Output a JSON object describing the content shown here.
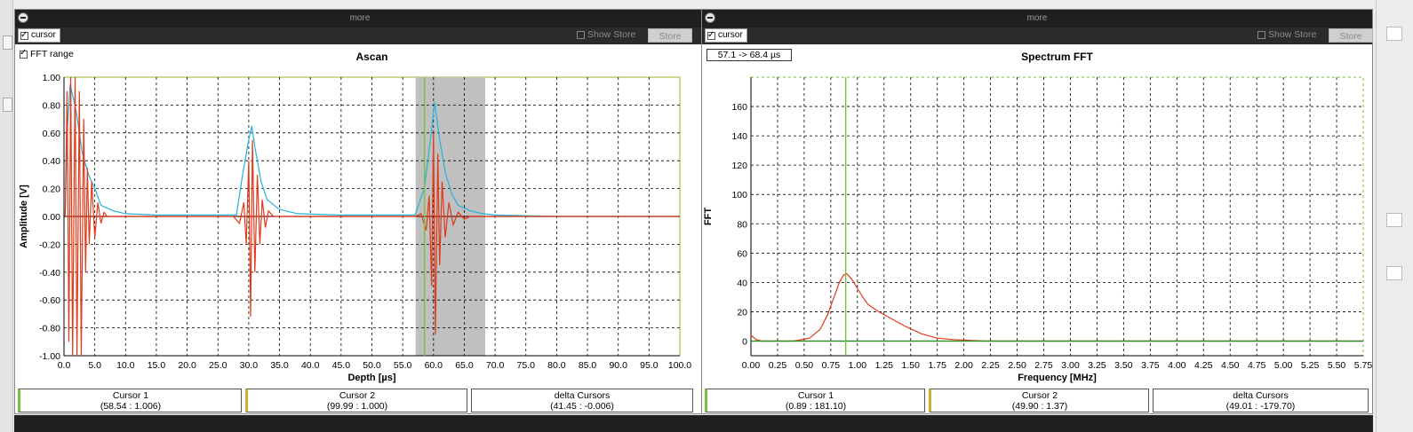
{
  "left_panel": {
    "title_bar": "more",
    "cursor_label": "cursor",
    "show_store_label": "Show Store",
    "store_label": "Store",
    "fft_range_label": "FFT range",
    "cursor1": {
      "title": "Cursor 1",
      "value": "(58.54 : 1.006)"
    },
    "cursor2": {
      "title": "Cursor 2",
      "value": "(99.99 : 1.000)"
    },
    "delta": {
      "title": "delta Cursors",
      "value": "(41.45 : -0.006)"
    }
  },
  "right_panel": {
    "title_bar": "more",
    "cursor_label": "cursor",
    "show_store_label": "Show Store",
    "store_label": "Store",
    "range_label": "57.1 -> 68.4 µs",
    "cursor1": {
      "title": "Cursor 1",
      "value": "(0.89 : 181.10)"
    },
    "cursor2": {
      "title": "Cursor 2",
      "value": "(49.90 : 1.37)"
    },
    "delta": {
      "title": "delta Cursors",
      "value": "(49.01 : -179.70)"
    }
  },
  "chart_data": [
    {
      "type": "line",
      "title": "Ascan",
      "xlabel": "Depth [µs]",
      "ylabel": "Amplitude [V]",
      "xlim": [
        0,
        100
      ],
      "ylim": [
        -1,
        1
      ],
      "x_ticks": [
        "0.0",
        "5.0",
        "10.0",
        "15.0",
        "20.0",
        "25.0",
        "30.0",
        "35.0",
        "40.0",
        "45.0",
        "50.0",
        "55.0",
        "60.0",
        "65.0",
        "70.0",
        "75.0",
        "80.0",
        "85.0",
        "90.0",
        "95.0",
        "100.0"
      ],
      "y_ticks": [
        "1.00",
        "0.80",
        "0.60",
        "0.40",
        "0.20",
        "0.00",
        "-0.20",
        "-0.40",
        "-0.60",
        "-0.80",
        "-1.00"
      ],
      "grid": true,
      "fft_window": [
        57.1,
        68.4
      ],
      "cursor1_x": 58.54,
      "colors": {
        "signal": "#e03a1a",
        "envelope": "#22b4d8",
        "cursor": "#7bbf3a",
        "window": "#c0c0c0"
      },
      "series": [
        {
          "color": "#22b4d8",
          "points": [
            [
              0.2,
              0.0
            ],
            [
              0.5,
              0.6
            ],
            [
              1,
              0.95
            ],
            [
              2,
              0.75
            ],
            [
              3,
              0.45
            ],
            [
              4,
              0.3
            ],
            [
              5,
              0.2
            ],
            [
              6,
              0.08
            ],
            [
              8,
              0.04
            ],
            [
              10,
              0.02
            ],
            [
              15,
              0.01
            ],
            [
              28,
              0.01
            ],
            [
              29,
              0.3
            ],
            [
              30,
              0.55
            ],
            [
              30.5,
              0.65
            ],
            [
              31,
              0.5
            ],
            [
              32,
              0.25
            ],
            [
              33,
              0.12
            ],
            [
              35,
              0.05
            ],
            [
              38,
              0.02
            ],
            [
              45,
              0.01
            ],
            [
              57,
              0.01
            ],
            [
              58.5,
              0.2
            ],
            [
              59.5,
              0.55
            ],
            [
              60.2,
              0.82
            ],
            [
              61,
              0.55
            ],
            [
              62,
              0.3
            ],
            [
              63,
              0.16
            ],
            [
              64,
              0.08
            ],
            [
              66,
              0.04
            ],
            [
              68,
              0.02
            ],
            [
              70,
              0.01
            ],
            [
              80,
              0.0
            ],
            [
              100,
              0.0
            ]
          ]
        },
        {
          "color": "#e03a1a",
          "points": [
            [
              0.2,
              0.0
            ],
            [
              0.5,
              0.9
            ],
            [
              0.8,
              -0.9
            ],
            [
              1.1,
              1.0
            ],
            [
              1.4,
              -1.0
            ],
            [
              1.8,
              1.0
            ],
            [
              2.1,
              -1.0
            ],
            [
              2.5,
              0.9
            ],
            [
              2.8,
              -1.0
            ],
            [
              3.2,
              0.7
            ],
            [
              3.5,
              -0.4
            ],
            [
              3.8,
              0.35
            ],
            [
              4.1,
              -0.2
            ],
            [
              4.5,
              0.25
            ],
            [
              5,
              -0.15
            ],
            [
              5.5,
              0.1
            ],
            [
              6,
              -0.05
            ],
            [
              6.5,
              0.03
            ],
            [
              7,
              0.0
            ],
            [
              27.5,
              0.0
            ],
            [
              28.5,
              -0.05
            ],
            [
              29.2,
              0.1
            ],
            [
              29.6,
              -0.2
            ],
            [
              30,
              0.4
            ],
            [
              30.3,
              -0.72
            ],
            [
              30.6,
              0.55
            ],
            [
              31,
              -0.4
            ],
            [
              31.4,
              0.3
            ],
            [
              31.8,
              -0.2
            ],
            [
              32.2,
              0.12
            ],
            [
              32.7,
              -0.08
            ],
            [
              33.2,
              0.04
            ],
            [
              34,
              0.0
            ],
            [
              57,
              0.0
            ],
            [
              58,
              0.02
            ],
            [
              58.8,
              -0.1
            ],
            [
              59.3,
              0.15
            ],
            [
              59.7,
              -0.5
            ],
            [
              60,
              0.6
            ],
            [
              60.3,
              -0.85
            ],
            [
              60.7,
              0.45
            ],
            [
              61,
              -0.35
            ],
            [
              61.4,
              0.25
            ],
            [
              61.9,
              -0.15
            ],
            [
              62.5,
              0.1
            ],
            [
              63.2,
              -0.06
            ],
            [
              64,
              0.03
            ],
            [
              65,
              -0.02
            ],
            [
              66,
              0.0
            ],
            [
              78,
              0.0
            ],
            [
              100,
              0.0
            ]
          ]
        }
      ]
    },
    {
      "type": "line",
      "title": "Spectrum FFT",
      "xlabel": "Frequency [MHz]",
      "ylabel": "FFT",
      "xlim": [
        0,
        5.75
      ],
      "ylim": [
        -10,
        180
      ],
      "x_ticks": [
        "0.00",
        "0.25",
        "0.50",
        "0.75",
        "1.00",
        "1.25",
        "1.50",
        "1.75",
        "2.00",
        "2.25",
        "2.50",
        "2.75",
        "3.00",
        "3.25",
        "3.50",
        "3.75",
        "4.00",
        "4.25",
        "4.50",
        "4.75",
        "5.00",
        "5.25",
        "5.50",
        "5.75"
      ],
      "y_ticks": [
        "160",
        "140",
        "120",
        "100",
        "80",
        "60",
        "40",
        "20",
        "0"
      ],
      "grid": true,
      "cursor1_x": 0.89,
      "colors": {
        "spectrum": "#e03a1a",
        "baseline": "#2a8a2a",
        "cursor": "#7bbf3a"
      },
      "series": [
        {
          "color": "#e03a1a",
          "points": [
            [
              0.0,
              4
            ],
            [
              0.05,
              1
            ],
            [
              0.1,
              0
            ],
            [
              0.4,
              0
            ],
            [
              0.55,
              2
            ],
            [
              0.65,
              8
            ],
            [
              0.72,
              18
            ],
            [
              0.78,
              30
            ],
            [
              0.83,
              40
            ],
            [
              0.87,
              45
            ],
            [
              0.9,
              46
            ],
            [
              0.95,
              42
            ],
            [
              1.0,
              36
            ],
            [
              1.05,
              30
            ],
            [
              1.1,
              25
            ],
            [
              1.2,
              20
            ],
            [
              1.3,
              16
            ],
            [
              1.45,
              10
            ],
            [
              1.6,
              5
            ],
            [
              1.75,
              2
            ],
            [
              1.9,
              1
            ],
            [
              2.2,
              0
            ],
            [
              3.0,
              0
            ],
            [
              5.75,
              0
            ]
          ]
        },
        {
          "color": "#2a8a2a",
          "points": [
            [
              0,
              0
            ],
            [
              5.75,
              0
            ]
          ]
        }
      ]
    }
  ]
}
